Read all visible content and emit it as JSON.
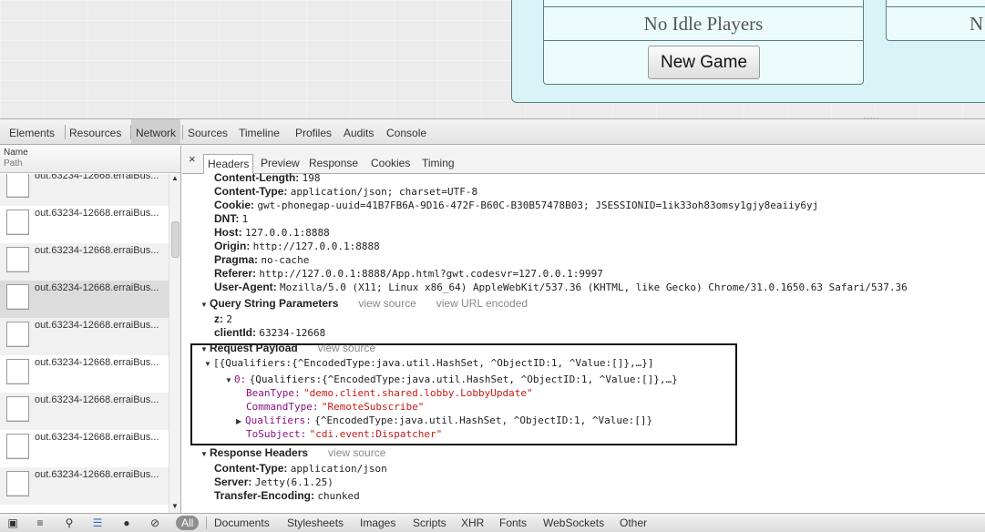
{
  "page": {
    "idle_text": "No Idle Players",
    "new_game_label": "New Game",
    "right_partial_text": "N",
    "resize_grip": "....."
  },
  "devtools": {
    "tabs": [
      "Elements",
      "Resources",
      "Network",
      "Sources",
      "Timeline",
      "Profiles",
      "Audits",
      "Console"
    ],
    "active_tab": "Network",
    "list": {
      "header_name": "Name",
      "header_path": "Path",
      "rows": [
        "out.63234-12668.erraiBus...",
        "out.63234-12668.erraiBus...",
        "out.63234-12668.erraiBus...",
        "out.63234-12668.erraiBus...",
        "out.63234-12668.erraiBus...",
        "out.63234-12668.erraiBus...",
        "out.63234-12668.erraiBus...",
        "out.63234-12668.erraiBus...",
        "out.63234-12668.erraiBus..."
      ]
    },
    "detail": {
      "close_glyph": "×",
      "tabs": [
        "Headers",
        "Preview",
        "Response",
        "Cookies",
        "Timing"
      ],
      "active_tab": "Headers",
      "request_headers": [
        {
          "key": "Content-Length:",
          "value": "198"
        },
        {
          "key": "Content-Type:",
          "value": "application/json; charset=UTF-8"
        },
        {
          "key": "Cookie:",
          "value": "gwt-phonegap-uuid=41B7FB6A-9D16-472F-B60C-B30B57478B03; JSESSIONID=1ik33oh83omsy1gjy8eaiiy6yj"
        },
        {
          "key": "DNT:",
          "value": "1"
        },
        {
          "key": "Host:",
          "value": "127.0.0.1:8888"
        },
        {
          "key": "Origin:",
          "value": "http://127.0.0.1:8888"
        },
        {
          "key": "Pragma:",
          "value": "no-cache"
        },
        {
          "key": "Referer:",
          "value": "http://127.0.0.1:8888/App.html?gwt.codesvr=127.0.0.1:9997"
        },
        {
          "key": "User-Agent:",
          "value": "Mozilla/5.0 (X11; Linux x86_64) AppleWebKit/537.36 (KHTML, like Gecko) Chrome/31.0.1650.63 Safari/537.36"
        }
      ],
      "query_section": {
        "title": "Query String Parameters",
        "view_source": "view source",
        "view_url_encoded": "view URL encoded",
        "params": [
          {
            "key": "z:",
            "value": "2"
          },
          {
            "key": "clientId:",
            "value": "63234-12668"
          }
        ]
      },
      "payload_section": {
        "title": "Request Payload",
        "view_source": "view source",
        "root": "[{Qualifiers:{^EncodedType:java.util.HashSet, ^ObjectID:1, ^Value:[]},…}]",
        "item0_key": "0:",
        "item0_value": "{Qualifiers:{^EncodedType:java.util.HashSet, ^ObjectID:1, ^Value:[]},…}",
        "fields": [
          {
            "key": "BeanType:",
            "value": "\"demo.client.shared.lobby.LobbyUpdate\""
          },
          {
            "key": "CommandType:",
            "value": "\"RemoteSubscribe\""
          },
          {
            "key": "Qualifiers:",
            "value": "{^EncodedType:java.util.HashSet, ^ObjectID:1, ^Value:[]}"
          },
          {
            "key": "ToSubject:",
            "value": "\"cdi.event:Dispatcher\""
          }
        ]
      },
      "response_section": {
        "title": "Response Headers",
        "view_source": "view source",
        "headers": [
          {
            "key": "Content-Type:",
            "value": "application/json"
          },
          {
            "key": "Server:",
            "value": "Jetty(6.1.25)"
          },
          {
            "key": "Transfer-Encoding:",
            "value": "chunked"
          }
        ]
      }
    },
    "status_bar": {
      "icons": [
        "dock-icon",
        "console-drawer-icon",
        "search-icon",
        "list-view-icon",
        "record-icon",
        "clear-icon"
      ],
      "filters": [
        "All",
        "Documents",
        "Stylesheets",
        "Images",
        "Scripts",
        "XHR",
        "Fonts",
        "WebSockets",
        "Other"
      ],
      "active_filter": "All"
    }
  }
}
